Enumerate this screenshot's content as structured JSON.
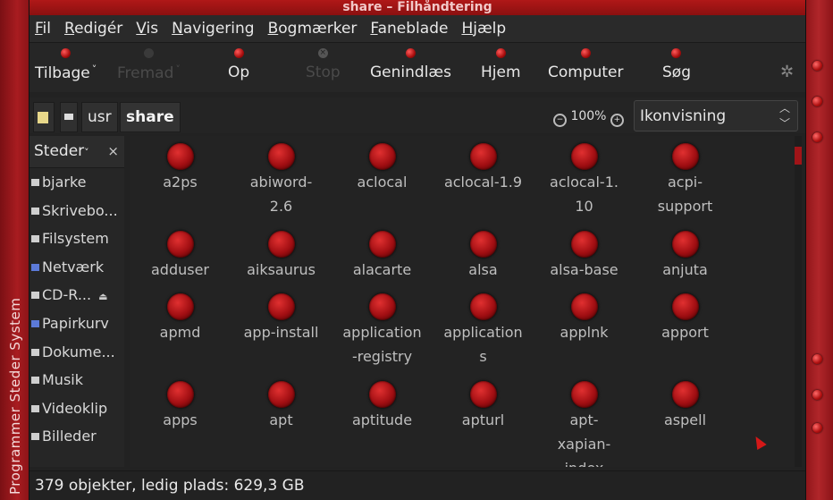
{
  "window_title": "share – Filhåndtering",
  "panel_text": "Programmer  Steder  System",
  "menu": [
    "Fil",
    "Redigér",
    "Vis",
    "Navigering",
    "Bogmærker",
    "Faneblade",
    "Hjælp"
  ],
  "toolbar": {
    "back": "Tilbage",
    "forward": "Fremad",
    "up": "Op",
    "stop": "Stop",
    "reload": "Genindlæs",
    "home": "Hjem",
    "computer": "Computer",
    "search": "Søg"
  },
  "location": {
    "crumbs": [
      "usr",
      "share"
    ],
    "zoom": "100%",
    "view_mode": "Ikonvisning"
  },
  "sidebar": {
    "header": "Steder",
    "items": [
      "bjarke",
      "Skrivebo...",
      "Filsystem",
      "Netværk",
      "CD-R...",
      "Papirkurv",
      "Dokume...",
      "Musik",
      "Videoklip",
      "Billeder"
    ]
  },
  "files": [
    "a2ps",
    "abiword-\n2.6",
    "aclocal",
    "aclocal-1.9",
    "aclocal-1.\n10",
    "acpi-\nsupport",
    "adduser",
    "aiksaurus",
    "alacarte",
    "alsa",
    "alsa-base",
    "anjuta",
    "apmd",
    "app-install",
    "application\n-registry",
    "application\ns",
    "applnk",
    "apport",
    "apps",
    "apt",
    "aptitude",
    "apturl",
    "apt-\nxapian-\nindex",
    "aspell"
  ],
  "status": "379 objekter, ledig plads: 629,3 GB",
  "colors": {
    "accent": "#b01818",
    "background": "#232323"
  }
}
